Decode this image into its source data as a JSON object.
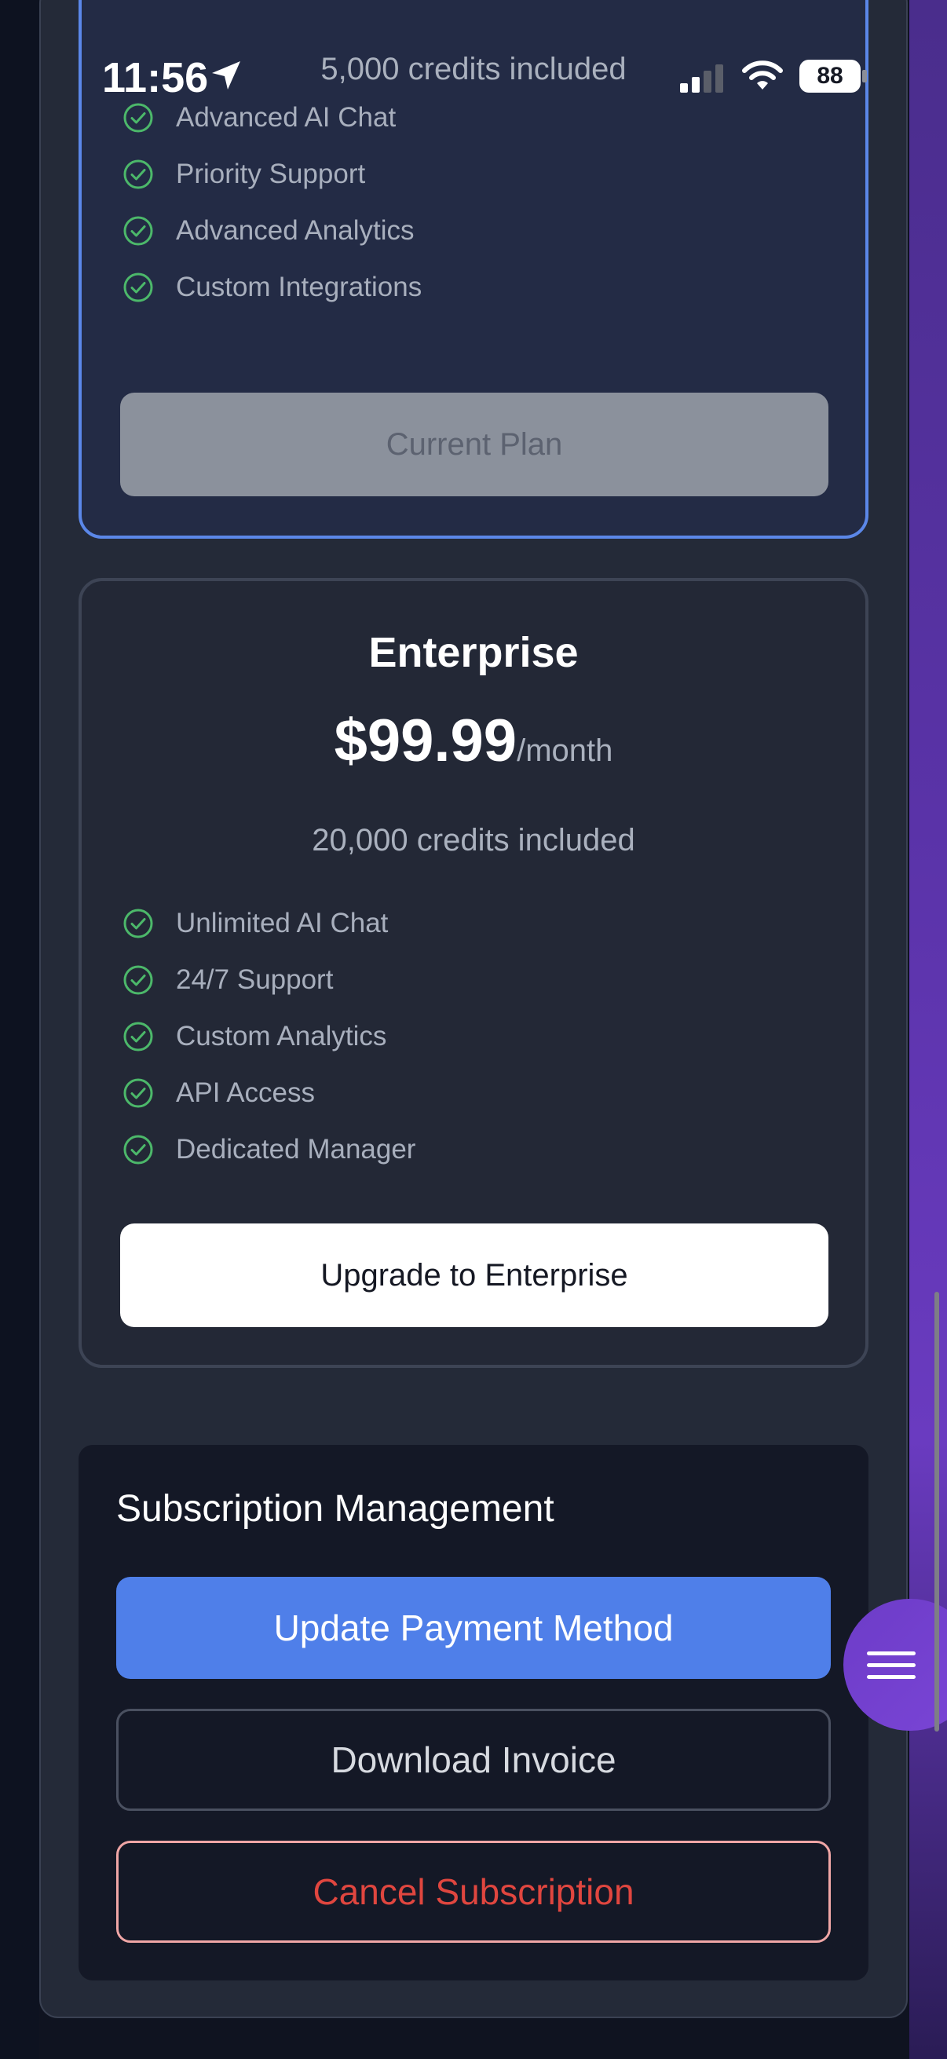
{
  "status_bar": {
    "time": "11:56",
    "battery": "88"
  },
  "pro_plan": {
    "credits": "5,000 credits included",
    "features": [
      "Advanced AI Chat",
      "Priority Support",
      "Advanced Analytics",
      "Custom Integrations"
    ],
    "button_label": "Current Plan"
  },
  "enterprise_plan": {
    "name": "Enterprise",
    "price": "$99.99",
    "period": "/month",
    "credits": "20,000 credits included",
    "features": [
      "Unlimited AI Chat",
      "24/7 Support",
      "Custom Analytics",
      "API Access",
      "Dedicated Manager"
    ],
    "button_label": "Upgrade to Enterprise"
  },
  "subscription_management": {
    "title": "Subscription Management",
    "update_payment_label": "Update Payment Method",
    "download_invoice_label": "Download Invoice",
    "cancel_label": "Cancel Subscription"
  },
  "colors": {
    "accent_blue": "#4f7fe9",
    "check_green": "#4cb86a",
    "danger_red": "#e0463f",
    "fab_purple": "#7a45d6"
  },
  "icons": {
    "location": "location-arrow-icon",
    "signal": "cellular-signal-icon",
    "wifi": "wifi-icon",
    "check": "check-circle-icon",
    "menu": "hamburger-menu-icon"
  }
}
